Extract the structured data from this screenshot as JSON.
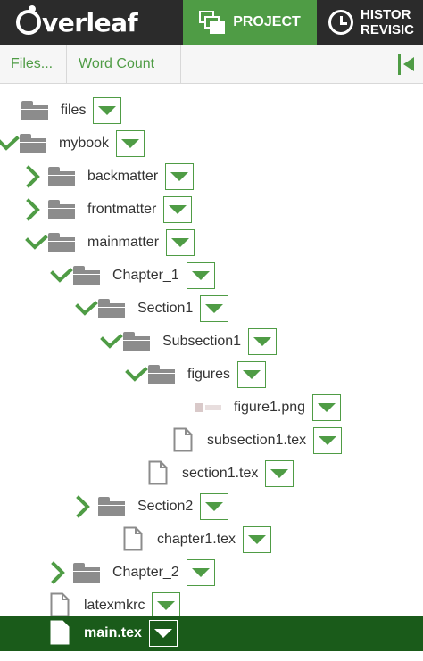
{
  "header": {
    "logo_text": "verleaf",
    "project_tab": "PROJECT",
    "history_line1": "HISTOR",
    "history_line2": "REVISIC"
  },
  "toolbar": {
    "files_label": "Files...",
    "word_count_label": "Word Count"
  },
  "tree": [
    {
      "label": "files",
      "type": "folder",
      "expanded": null
    },
    {
      "label": "mybook",
      "type": "folder",
      "expanded": true
    },
    {
      "label": "backmatter",
      "type": "folder",
      "expanded": false
    },
    {
      "label": "frontmatter",
      "type": "folder",
      "expanded": false
    },
    {
      "label": "mainmatter",
      "type": "folder",
      "expanded": true
    },
    {
      "label": "Chapter_1",
      "type": "folder",
      "expanded": true
    },
    {
      "label": "Section1",
      "type": "folder",
      "expanded": true
    },
    {
      "label": "Subsection1",
      "type": "folder",
      "expanded": true
    },
    {
      "label": "figures",
      "type": "folder",
      "expanded": true
    },
    {
      "label": "figure1.png",
      "type": "image"
    },
    {
      "label": "subsection1.tex",
      "type": "file"
    },
    {
      "label": "section1.tex",
      "type": "file"
    },
    {
      "label": "Section2",
      "type": "folder",
      "expanded": false
    },
    {
      "label": "chapter1.tex",
      "type": "file"
    },
    {
      "label": "Chapter_2",
      "type": "folder",
      "expanded": false
    },
    {
      "label": "latexmkrc",
      "type": "file"
    },
    {
      "label": "main.tex",
      "type": "file",
      "selected": true
    }
  ],
  "colors": {
    "accent": "#4f9c45",
    "header_bg": "#2b2b2b",
    "selected_bg": "#1a5b1a",
    "folder": "#8c8c8c"
  }
}
